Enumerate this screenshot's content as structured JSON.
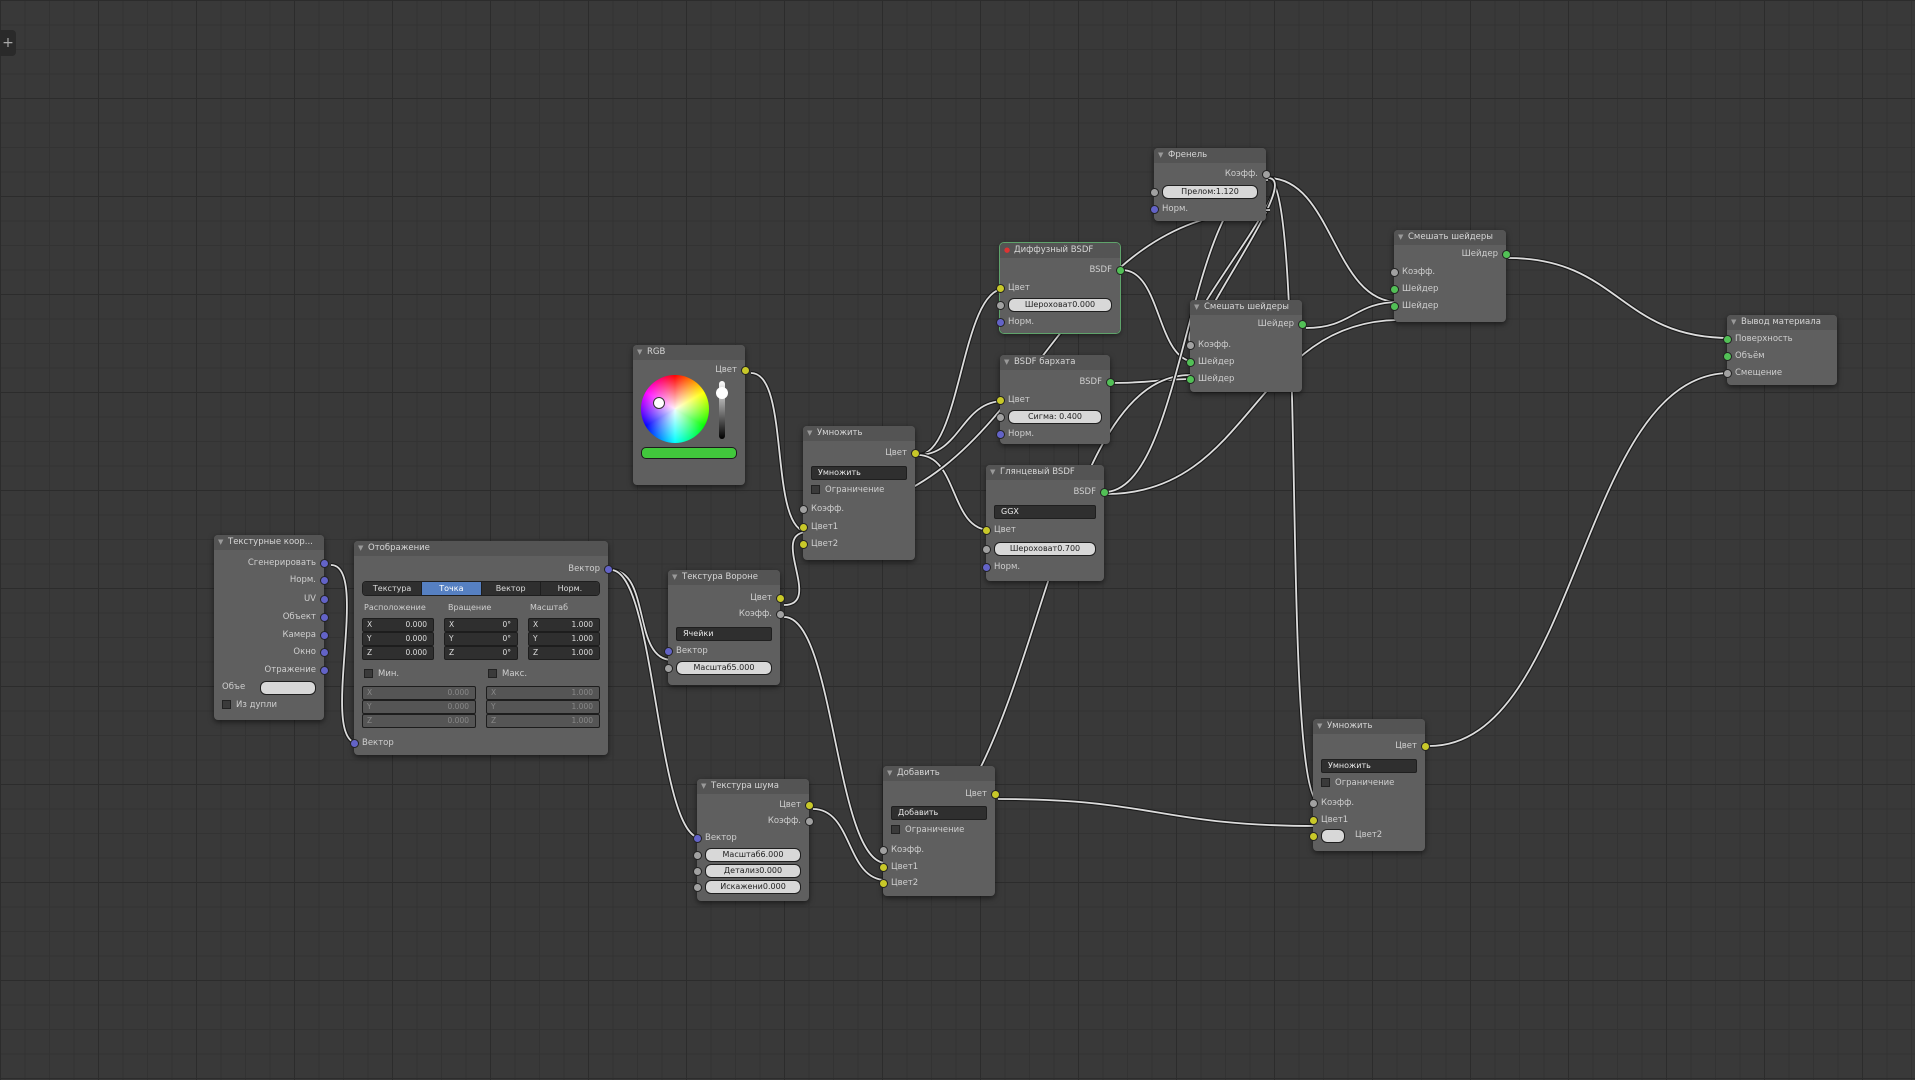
{
  "colors": {
    "background": "#393939",
    "node_body": "#5f5f5f",
    "socket_color": "#c8c829",
    "socket_shader": "#52c56",
    "socket_vector": "#6363c7",
    "socket_float": "#a1a1a1",
    "rgb_swatch": "#41c83c",
    "active_tab": "#5680c2"
  },
  "nodes": {
    "texcoord": {
      "title": "Текстурные коор...",
      "outputs": [
        "Сгенерировать",
        "Норм.",
        "UV",
        "Объект",
        "Камера",
        "Окно",
        "Отражение"
      ],
      "object_label": "Объе",
      "object_value": "",
      "dupli_label": "Из дупли"
    },
    "mapping": {
      "title": "Отображение",
      "output": "Вектор",
      "tabs": [
        "Текстура",
        "Точка",
        "Вектор",
        "Норм."
      ],
      "loc_header": "Расположение",
      "rot_header": "Вращение",
      "scale_header": "Масштаб",
      "loc": [
        "0.000",
        "0.000",
        "0.000"
      ],
      "rot": [
        "0°",
        "0°",
        "0°"
      ],
      "scale": [
        "1.000",
        "1.000",
        "1.000"
      ],
      "axes": [
        "X",
        "Y",
        "Z"
      ],
      "min_label": "Мин.",
      "max_label": "Макс.",
      "min": [
        "0.000",
        "0.000",
        "0.000"
      ],
      "max": [
        "1.000",
        "1.000",
        "1.000"
      ],
      "input": "Вектор"
    },
    "rgb": {
      "title": "RGB",
      "output": "Цвет"
    },
    "voronoi": {
      "title": "Текстура Вороне",
      "out_color": "Цвет",
      "out_fac": "Коэфф.",
      "coloring": "Ячейки",
      "in_vector": "Вектор",
      "scale": "Масштаб5.000"
    },
    "noise": {
      "title": "Текстура шума",
      "out_color": "Цвет",
      "out_fac": "Коэфф.",
      "in_vector": "Вектор",
      "scale": "Масштаб6.000",
      "detail": "Детализ0.000",
      "distortion": "Искажени0.000"
    },
    "mix1": {
      "title": "Умножить",
      "out_color": "Цвет",
      "blend": "Умножить",
      "clamp": "Ограничение",
      "fac": "Коэфф.",
      "c1": "Цвет1",
      "c2": "Цвет2"
    },
    "add": {
      "title": "Добавить",
      "out_color": "Цвет",
      "blend": "Добавить",
      "clamp": "Ограничение",
      "fac": "Коэфф.",
      "c1": "Цвет1",
      "c2": "Цвет2"
    },
    "mix2": {
      "title": "Умножить",
      "out_color": "Цвет",
      "blend": "Умножить",
      "clamp": "Ограничение",
      "fac": "Коэфф.",
      "c1": "Цвет1",
      "c2": "Цвет2"
    },
    "diffuse": {
      "title": "Диффузный BSDF",
      "out": "BSDF",
      "color": "Цвет",
      "roughness": "Шероховат0.000",
      "normal": "Норм."
    },
    "velvet": {
      "title": "BSDF бархата",
      "out": "BSDF",
      "color": "Цвет",
      "sigma": "Сигма: 0.400",
      "normal": "Норм."
    },
    "glossy": {
      "title": "Глянцевый BSDF",
      "out": "BSDF",
      "distribution": "GGX",
      "color": "Цвет",
      "roughness": "Шероховат0.700",
      "normal": "Норм."
    },
    "fresnel": {
      "title": "Френель",
      "out": "Коэфф.",
      "ior": "Прелом:1.120",
      "normal": "Норм."
    },
    "mixshader1": {
      "title": "Смешать шейдеры",
      "out": "Шейдер",
      "fac": "Коэфф.",
      "s1": "Шейдер",
      "s2": "Шейдер"
    },
    "mixshader2": {
      "title": "Смешать шейдеры",
      "out": "Шейдер",
      "fac": "Коэфф.",
      "s1": "Шейдер",
      "s2": "Шейдер"
    },
    "output": {
      "title": "Вывод материала",
      "surface": "Поверхность",
      "volume": "Объём",
      "displacement": "Смещение"
    }
  }
}
